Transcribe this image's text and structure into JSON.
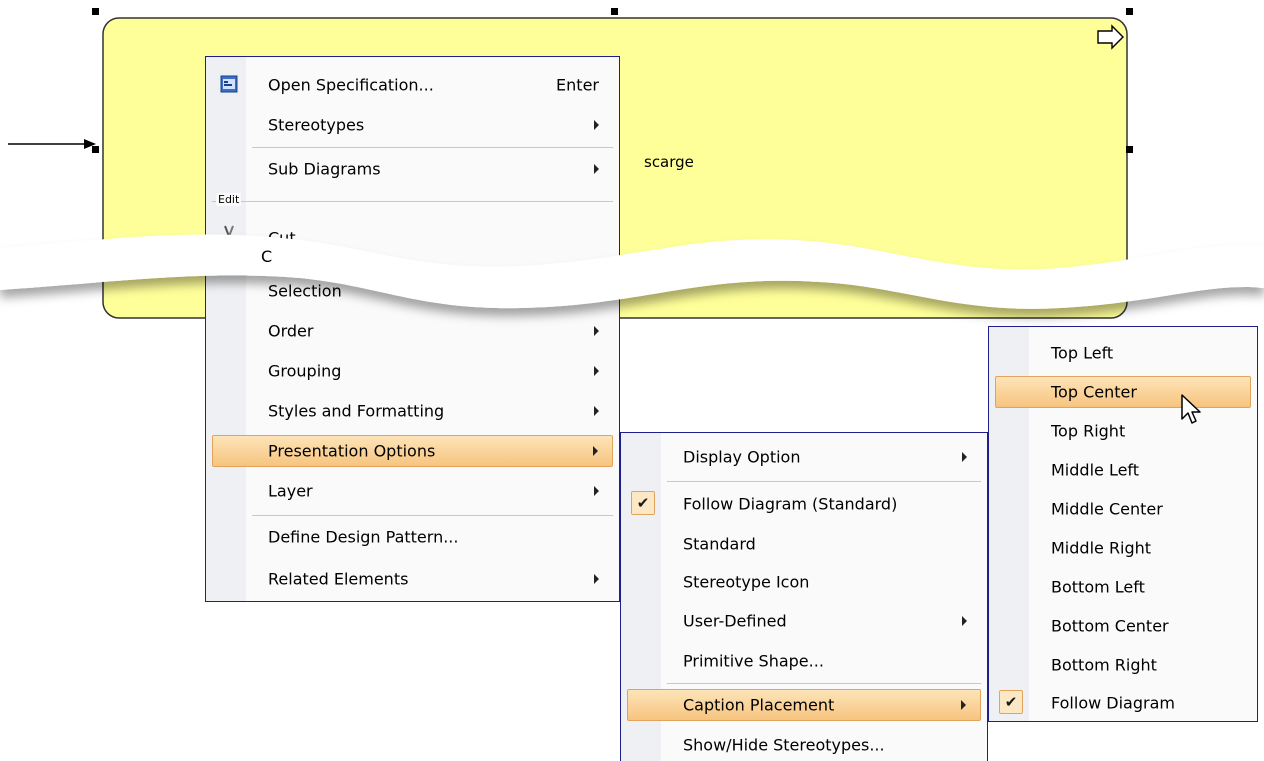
{
  "element": {
    "caption": "scarge"
  },
  "main_menu": {
    "items": [
      {
        "label": "Open Specification...",
        "shortcut": "Enter",
        "icon": "specification-icon"
      },
      {
        "label": "Stereotypes",
        "submenu": true
      },
      {
        "label": "Sub Diagrams",
        "submenu": true
      },
      {
        "label": "Cut",
        "icon": "scissors-icon"
      },
      {
        "label": "Selection"
      },
      {
        "label": "Order",
        "submenu": true
      },
      {
        "label": "Grouping",
        "submenu": true
      },
      {
        "label": "Styles and Formatting",
        "submenu": true
      },
      {
        "label": "Presentation Options",
        "submenu": true,
        "highlighted": true
      },
      {
        "label": "Layer",
        "submenu": true
      },
      {
        "label": "Define Design Pattern..."
      },
      {
        "label": "Related Elements",
        "submenu": true
      }
    ],
    "group_edit_label": "Edit",
    "partial_item_fragment": "C",
    "partial_item_tail": "ction"
  },
  "presentation_menu": {
    "items": [
      {
        "label": "Display Option",
        "submenu": true
      },
      {
        "label": "Follow Diagram (Standard)",
        "checked": true
      },
      {
        "label": "Standard"
      },
      {
        "label": "Stereotype Icon"
      },
      {
        "label": "User-Defined",
        "submenu": true
      },
      {
        "label": "Primitive Shape..."
      },
      {
        "label": "Caption Placement",
        "submenu": true,
        "highlighted": true
      },
      {
        "label": "Show/Hide Stereotypes..."
      }
    ]
  },
  "caption_menu": {
    "items": [
      {
        "label": "Top Left"
      },
      {
        "label": "Top Center",
        "highlighted": true
      },
      {
        "label": "Top Right"
      },
      {
        "label": "Middle Left"
      },
      {
        "label": "Middle Center"
      },
      {
        "label": "Middle Right"
      },
      {
        "label": "Bottom Left"
      },
      {
        "label": "Bottom Center"
      },
      {
        "label": "Bottom Right"
      },
      {
        "label": "Follow Diagram",
        "checked": true
      }
    ]
  },
  "colors": {
    "shape_fill": "#ffff99",
    "menu_border": "#1e1e8c",
    "highlight_top": "#fde4b8",
    "highlight_bottom": "#f7c47f"
  }
}
